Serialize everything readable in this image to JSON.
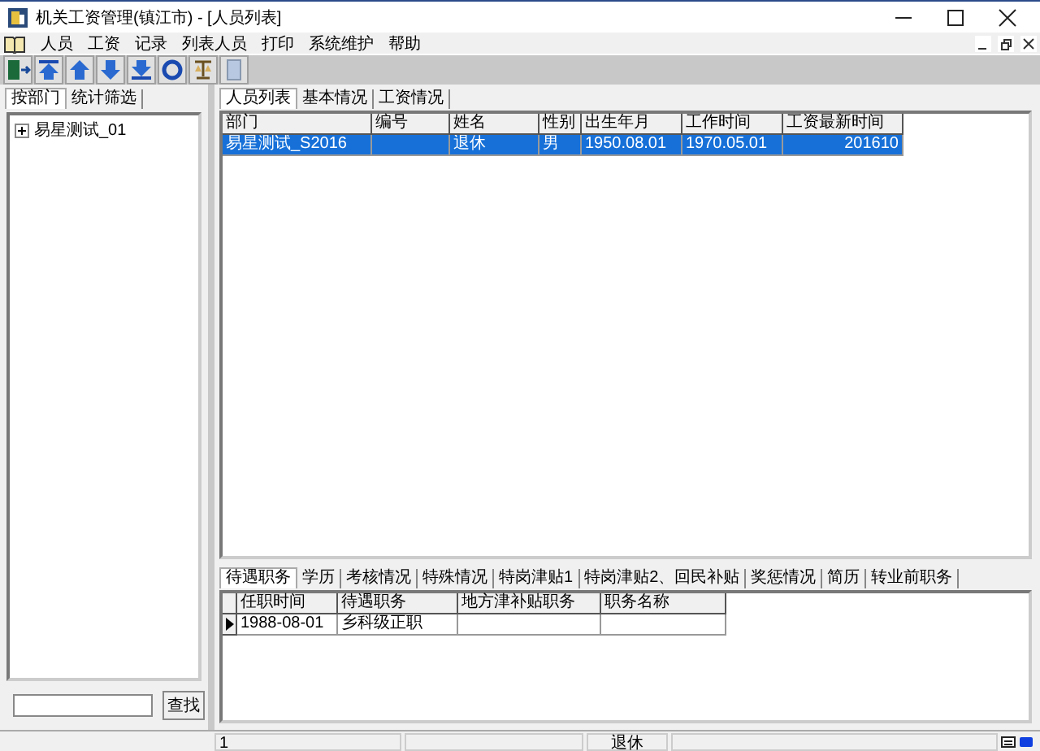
{
  "window": {
    "title": "机关工资管理(镇江市) - [人员列表]"
  },
  "menu": [
    "人员",
    "工资",
    "记录",
    "列表人员",
    "打印",
    "系统维护",
    "帮助"
  ],
  "left_tabs": [
    {
      "label": "按部门",
      "selected": true
    },
    {
      "label": "统计筛选",
      "selected": false
    }
  ],
  "tree": [
    {
      "label": "易星测试_01",
      "expanded": false
    }
  ],
  "search": {
    "button": "查找"
  },
  "tabs": [
    {
      "label": "人员列表",
      "selected": true
    },
    {
      "label": "基本情况",
      "selected": false
    },
    {
      "label": "工资情况",
      "selected": false
    }
  ],
  "table": {
    "columns": [
      "部门",
      "编号",
      "姓名",
      "性别",
      "出生年月",
      "工作时间",
      "工资最新时间"
    ],
    "rows": [
      {
        "cells": [
          "易星测试_S2016",
          "",
          "退休",
          "男",
          "1950.08.01",
          "1970.05.01",
          "201610"
        ],
        "selected": true
      }
    ]
  },
  "detail_tabs": [
    {
      "label": "待遇职务",
      "selected": true
    },
    {
      "label": "学历",
      "selected": false
    },
    {
      "label": "考核情况",
      "selected": false
    },
    {
      "label": "特殊情况",
      "selected": false
    },
    {
      "label": "特岗津贴1",
      "selected": false
    },
    {
      "label": "特岗津贴2、回民补贴",
      "selected": false
    },
    {
      "label": "奖惩情况",
      "selected": false
    },
    {
      "label": "简历",
      "selected": false
    },
    {
      "label": "转业前职务",
      "selected": false
    }
  ],
  "detail_table": {
    "columns": [
      "任职时间",
      "待遇职务",
      "地方津补贴职务",
      "职务名称"
    ],
    "rows": [
      {
        "cells": [
          "1988-08-01",
          "乡科级正职",
          "",
          ""
        ],
        "current": true
      }
    ]
  },
  "status_bar": {
    "record": "1",
    "status": "退休"
  }
}
